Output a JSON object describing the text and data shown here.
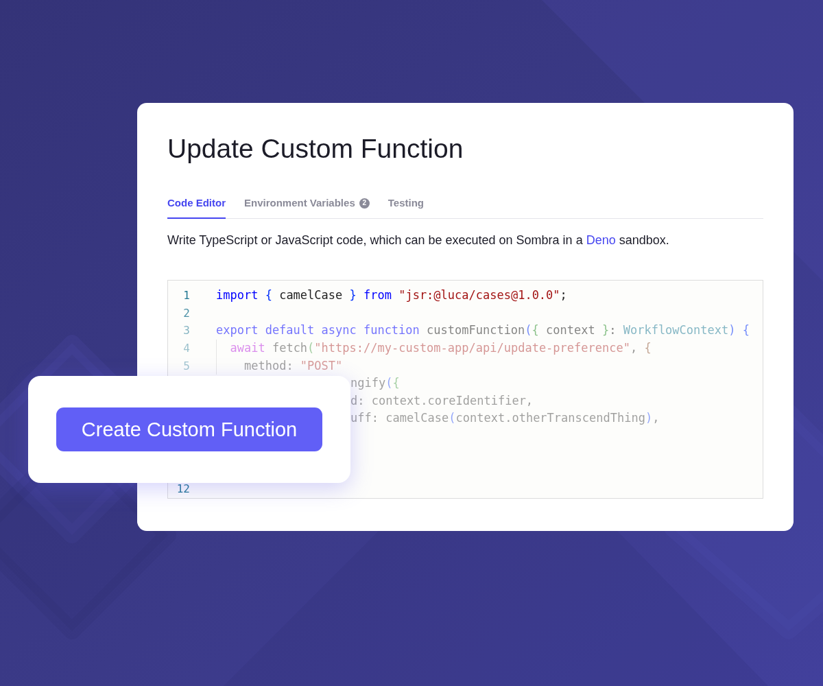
{
  "card": {
    "title": "Update Custom Function",
    "tabs": [
      {
        "label": "Code Editor",
        "selected": true
      },
      {
        "label": "Environment Variables",
        "badge": "2",
        "selected": false
      },
      {
        "label": "Testing",
        "selected": false
      }
    ],
    "description": [
      {
        "kind": "text",
        "text": "Write TypeScript or JavaScript code, which can be executed on Sombra in a "
      },
      {
        "kind": "link",
        "text": "Deno"
      },
      {
        "kind": "text",
        "text": " sandbox."
      }
    ],
    "editor": {
      "lines": [
        {
          "kind": "full",
          "number": "1",
          "tokens": [
            {
              "kind": "keyword",
              "text": "import "
            },
            {
              "kind": "bracket1",
              "text": "{"
            },
            {
              "kind": "ident",
              "text": " camelCase "
            },
            {
              "kind": "bracket1",
              "text": "}"
            },
            {
              "kind": "keyword",
              "text": " from "
            },
            {
              "kind": "string",
              "text": "\"jsr:@luca/cases@1.0.0\""
            },
            {
              "kind": "ident",
              "text": ";"
            }
          ]
        },
        {
          "kind": "full",
          "number": "2"
        },
        {
          "kind": "full",
          "number": "3",
          "tokens": [
            {
              "kind": "keyword",
              "text": "export default async function"
            },
            {
              "kind": "ident",
              "text": " customFunction"
            },
            {
              "kind": "bracket1",
              "text": "("
            },
            {
              "kind": "bracket2",
              "text": "{"
            },
            {
              "kind": "ident",
              "text": " context "
            },
            {
              "kind": "bracket2",
              "text": "}"
            },
            {
              "kind": "ident",
              "text": ": "
            },
            {
              "kind": "type",
              "text": "WorkflowContext"
            },
            {
              "kind": "bracket1",
              "text": ") {"
            }
          ]
        },
        {
          "kind": "full",
          "number": "4",
          "guide": true,
          "tokens": [
            {
              "kind": "control",
              "text": "await"
            },
            {
              "kind": "ident",
              "text": " fetch"
            },
            {
              "kind": "bracket2",
              "text": "("
            },
            {
              "kind": "string",
              "text": "\"https://my-custom-app/api/update-preference\""
            },
            {
              "kind": "ident",
              "text": ", "
            },
            {
              "kind": "bracket3",
              "text": "{"
            }
          ]
        },
        {
          "kind": "full",
          "number": "5",
          "guide": true,
          "tokens": [
            {
              "kind": "ident",
              "text": "  method: "
            },
            {
              "kind": "string",
              "text": "\"POST\""
            }
          ]
        },
        {
          "kind": "partial",
          "tokens": [
            {
              "kind": "ident",
              "text": "ngify"
            },
            {
              "kind": "bracket1",
              "text": "("
            },
            {
              "kind": "bracket2",
              "text": "{"
            }
          ]
        },
        {
          "kind": "partial",
          "tokens": [
            {
              "kind": "ident",
              "text": "d: context.coreIdentifier,"
            }
          ]
        },
        {
          "kind": "partial",
          "tokens": [
            {
              "kind": "ident",
              "text": "uff: camelCase"
            },
            {
              "kind": "bracket1",
              "text": "("
            },
            {
              "kind": "ident",
              "text": "context.otherTranscendThing"
            },
            {
              "kind": "bracket1",
              "text": ")"
            },
            {
              "kind": "ident",
              "text": ","
            }
          ]
        },
        {
          "kind": "full",
          "number": "12"
        }
      ]
    }
  },
  "floating_card": {
    "button": {
      "label": "Create Custom Function"
    }
  }
}
